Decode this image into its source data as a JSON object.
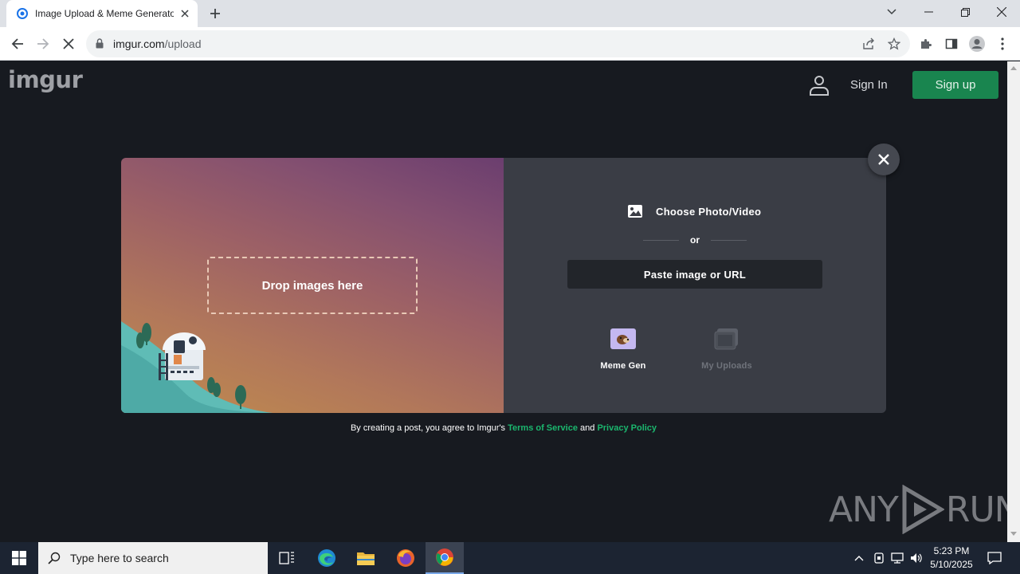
{
  "browser": {
    "tab_title": "Image Upload & Meme Generator - Imgur",
    "url_host": "imgur.com",
    "url_path": "/upload"
  },
  "site": {
    "logo_text": "imgur",
    "sign_in": "Sign In",
    "sign_up": "Sign up"
  },
  "upload": {
    "drop_text": "Drop images here",
    "choose_label": "Choose Photo/Video",
    "or_text": "or",
    "paste_label": "Paste image or URL",
    "meme_gen_label": "Meme Gen",
    "my_uploads_label": "My Uploads"
  },
  "terms": {
    "prefix": "By creating a post, you agree to Imgur's",
    "tos": "Terms of Service",
    "and": "and",
    "privacy": "Privacy Policy"
  },
  "watermark": {
    "left": "ANY",
    "right": "RUN"
  },
  "taskbar": {
    "search_placeholder": "Type here to search",
    "time": "5:23 PM",
    "date": "5/10/2025"
  },
  "colors": {
    "page_bg": "#171a20",
    "accent_green": "#1bb76e",
    "signup_bg": "#19854f",
    "panel_bg": "#3a3d45"
  }
}
